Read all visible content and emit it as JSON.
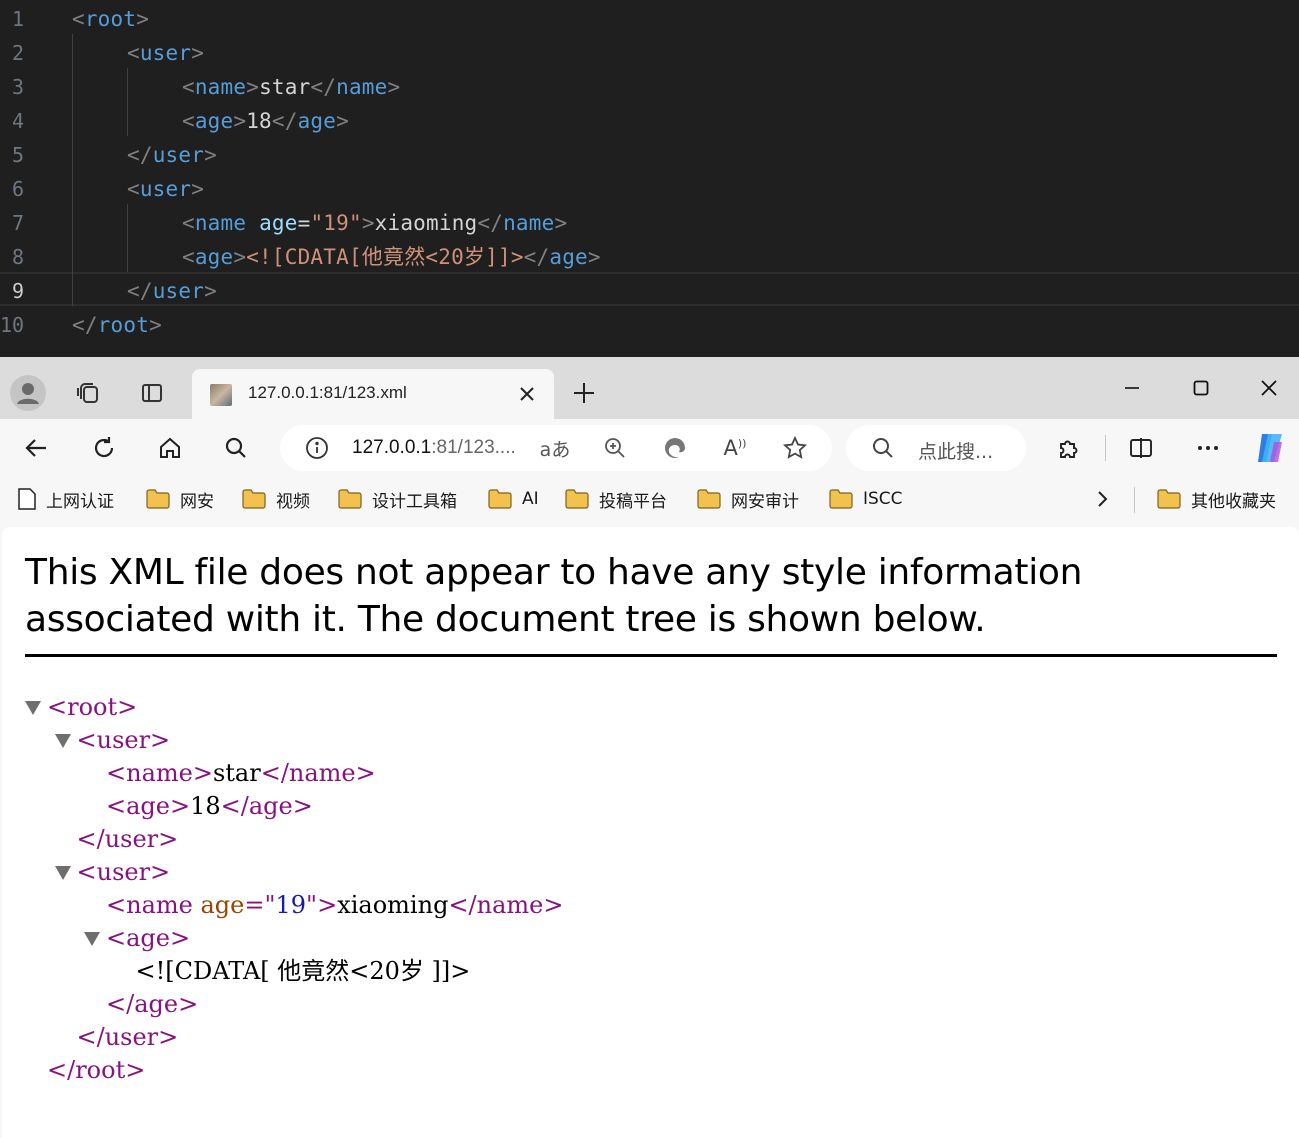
{
  "editor": {
    "current_line": "9",
    "lines": [
      {
        "num": "1",
        "indent": 0,
        "parts": [
          {
            "c": "t",
            "v": "<"
          },
          {
            "c": "tn",
            "v": "root"
          },
          {
            "c": "t",
            "v": ">"
          }
        ]
      },
      {
        "num": "2",
        "indent": 1,
        "parts": [
          {
            "c": "t",
            "v": "<"
          },
          {
            "c": "tn",
            "v": "user"
          },
          {
            "c": "t",
            "v": ">"
          }
        ]
      },
      {
        "num": "3",
        "indent": 2,
        "parts": [
          {
            "c": "t",
            "v": "<"
          },
          {
            "c": "tn",
            "v": "name"
          },
          {
            "c": "t",
            "v": ">"
          },
          {
            "c": "tx",
            "v": "star"
          },
          {
            "c": "t",
            "v": "</"
          },
          {
            "c": "tn",
            "v": "name"
          },
          {
            "c": "t",
            "v": ">"
          }
        ]
      },
      {
        "num": "4",
        "indent": 2,
        "parts": [
          {
            "c": "t",
            "v": "<"
          },
          {
            "c": "tn",
            "v": "age"
          },
          {
            "c": "t",
            "v": ">"
          },
          {
            "c": "tx",
            "v": "18"
          },
          {
            "c": "t",
            "v": "</"
          },
          {
            "c": "tn",
            "v": "age"
          },
          {
            "c": "t",
            "v": ">"
          }
        ]
      },
      {
        "num": "5",
        "indent": 1,
        "parts": [
          {
            "c": "t",
            "v": "</"
          },
          {
            "c": "tn",
            "v": "user"
          },
          {
            "c": "t",
            "v": ">"
          }
        ]
      },
      {
        "num": "6",
        "indent": 1,
        "parts": [
          {
            "c": "t",
            "v": "<"
          },
          {
            "c": "tn",
            "v": "user"
          },
          {
            "c": "t",
            "v": ">"
          }
        ]
      },
      {
        "num": "7",
        "indent": 2,
        "parts": [
          {
            "c": "t",
            "v": "<"
          },
          {
            "c": "tn",
            "v": "name"
          },
          {
            "c": "tx",
            "v": " "
          },
          {
            "c": "an",
            "v": "age"
          },
          {
            "c": "tx",
            "v": "="
          },
          {
            "c": "av",
            "v": "\"19\""
          },
          {
            "c": "t",
            "v": ">"
          },
          {
            "c": "tx",
            "v": "xiaoming"
          },
          {
            "c": "t",
            "v": "</"
          },
          {
            "c": "tn",
            "v": "name"
          },
          {
            "c": "t",
            "v": ">"
          }
        ]
      },
      {
        "num": "8",
        "indent": 2,
        "parts": [
          {
            "c": "t",
            "v": "<"
          },
          {
            "c": "tn",
            "v": "age"
          },
          {
            "c": "t",
            "v": ">"
          },
          {
            "c": "cd",
            "v": "<![CDATA[他竟然<20岁]]>"
          },
          {
            "c": "t",
            "v": "</"
          },
          {
            "c": "tn",
            "v": "age"
          },
          {
            "c": "t",
            "v": ">"
          }
        ]
      },
      {
        "num": "9",
        "indent": 1,
        "parts": [
          {
            "c": "t",
            "v": "</"
          },
          {
            "c": "tn",
            "v": "user"
          },
          {
            "c": "t",
            "v": ">"
          }
        ]
      },
      {
        "num": "10",
        "indent": 0,
        "parts": [
          {
            "c": "t",
            "v": "</"
          },
          {
            "c": "tn",
            "v": "root"
          },
          {
            "c": "t",
            "v": ">"
          }
        ]
      }
    ]
  },
  "browser": {
    "tab": {
      "title": "127.0.0.1:81/123.xml"
    },
    "address": {
      "host": "127.0.0.1",
      "rest": ":81/123...."
    },
    "search_placeholder": "点此搜...",
    "bookmarks": [
      {
        "label": "上网认证",
        "icon": "page-icon"
      },
      {
        "label": "网安",
        "icon": "folder-icon"
      },
      {
        "label": "视频",
        "icon": "folder-icon"
      },
      {
        "label": "设计工具箱",
        "icon": "folder-icon"
      },
      {
        "label": "AI",
        "icon": "folder-icon"
      },
      {
        "label": "投稿平台",
        "icon": "folder-icon"
      },
      {
        "label": "网安审计",
        "icon": "folder-icon"
      },
      {
        "label": "ISCC",
        "icon": "folder-icon"
      }
    ],
    "other_bookmarks": "其他收藏夹",
    "accent_color": "#f2c14e"
  },
  "page": {
    "info_message": "This XML file does not appear to have any style information associated with it. The document tree is shown below.",
    "tree": [
      {
        "depth": 0,
        "toggle": true,
        "parts": [
          {
            "c": "xt",
            "v": "<root>"
          }
        ]
      },
      {
        "depth": 1,
        "toggle": true,
        "parts": [
          {
            "c": "xt",
            "v": "<user>"
          }
        ]
      },
      {
        "depth": 2,
        "toggle": false,
        "parts": [
          {
            "c": "xt",
            "v": "<name>"
          },
          {
            "c": "x",
            "v": "star"
          },
          {
            "c": "xt",
            "v": "</name>"
          }
        ]
      },
      {
        "depth": 2,
        "toggle": false,
        "parts": [
          {
            "c": "xt",
            "v": "<age>"
          },
          {
            "c": "x",
            "v": "18"
          },
          {
            "c": "xt",
            "v": "</age>"
          }
        ]
      },
      {
        "depth": 1,
        "toggle": false,
        "parts": [
          {
            "c": "xt",
            "v": "</user>"
          }
        ]
      },
      {
        "depth": 1,
        "toggle": true,
        "parts": [
          {
            "c": "xt",
            "v": "<user>"
          }
        ]
      },
      {
        "depth": 2,
        "toggle": false,
        "parts": [
          {
            "c": "xt",
            "v": "<name "
          },
          {
            "c": "xa",
            "v": "age"
          },
          {
            "c": "xt",
            "v": "=\""
          },
          {
            "c": "xv",
            "v": "19"
          },
          {
            "c": "xt",
            "v": "\">"
          },
          {
            "c": "x",
            "v": "xiaoming"
          },
          {
            "c": "xt",
            "v": "</name>"
          }
        ]
      },
      {
        "depth": 2,
        "toggle": true,
        "parts": [
          {
            "c": "xt",
            "v": "<age>"
          }
        ]
      },
      {
        "depth": 3,
        "toggle": false,
        "parts": [
          {
            "c": "x",
            "v": "<![CDATA[ 他竟然<20岁 ]]>"
          }
        ]
      },
      {
        "depth": 2,
        "toggle": false,
        "parts": [
          {
            "c": "xt",
            "v": "</age>"
          }
        ]
      },
      {
        "depth": 1,
        "toggle": false,
        "parts": [
          {
            "c": "xt",
            "v": "</user>"
          }
        ]
      },
      {
        "depth": 0,
        "toggle": false,
        "parts": [
          {
            "c": "xt",
            "v": "</root>"
          }
        ]
      }
    ]
  }
}
